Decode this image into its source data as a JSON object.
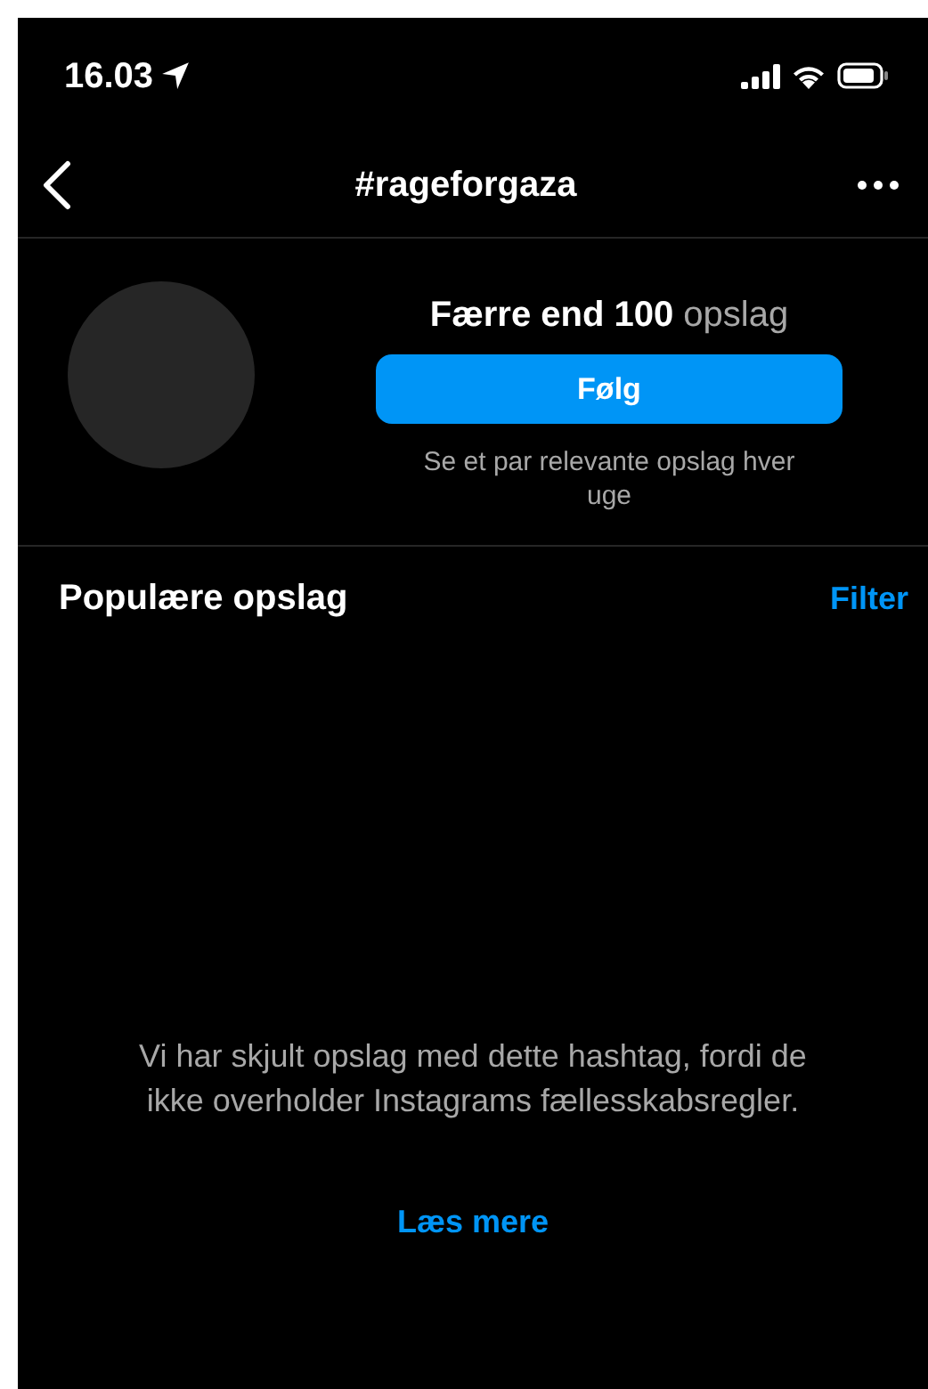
{
  "status_bar": {
    "time": "16.03"
  },
  "nav": {
    "title": "#rageforgaza"
  },
  "header": {
    "post_count": "**Færre end 100** opslag",
    "follow_button": "Følg",
    "subtitle": "Se et par relevante opslag hver uge"
  },
  "section": {
    "title": "Populære opslag",
    "filter": "Filter"
  },
  "notice": {
    "message": "Vi har skjult opslag med dette hashtag, fordi de ikke overholder Instagrams fællesskabsregler.",
    "link": "Læs mere"
  }
}
